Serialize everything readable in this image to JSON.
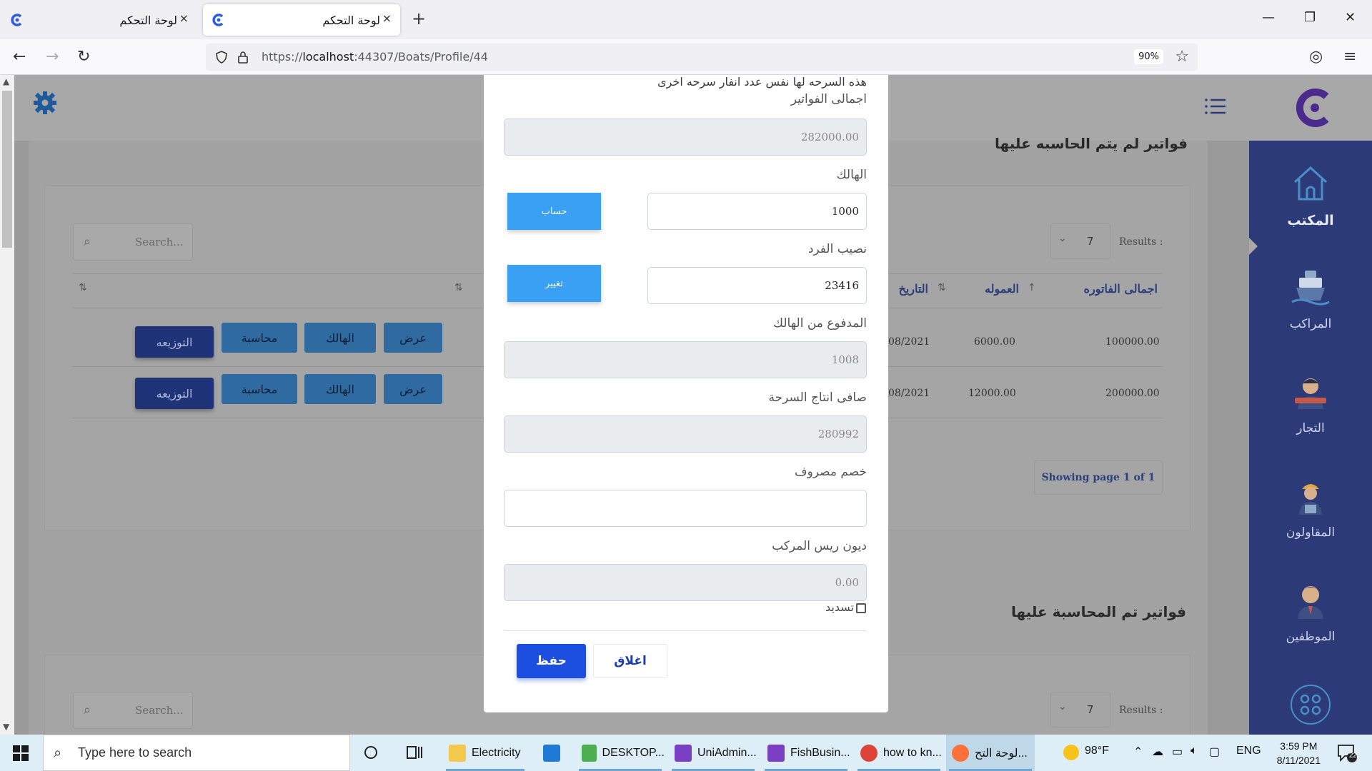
{
  "browser": {
    "tabs": [
      {
        "title": "لوحة التحكم",
        "active": false
      },
      {
        "title": "لوحة التحكم",
        "active": true
      }
    ],
    "url_prefix": "https://",
    "url_host": "localhost",
    "url_rest": ":44307/Boats/Profile/44",
    "zoom": "90%",
    "new_tab": "+",
    "close_glyph": "×",
    "minimize": "—",
    "restore": "❐",
    "close_window": "✕",
    "back": "←",
    "forward": "→",
    "reload": "↻",
    "star": "☆",
    "menu": "≡",
    "pocket": "◎"
  },
  "sidebar": {
    "items": [
      {
        "label": "المكتب",
        "icon": "house-icon",
        "active": true
      },
      {
        "label": "المراكب",
        "icon": "ship-icon",
        "active": false
      },
      {
        "label": "التجار",
        "icon": "merchant-icon",
        "active": false
      },
      {
        "label": "المقاولون",
        "icon": "contractor-icon",
        "active": false
      },
      {
        "label": "الموظفين",
        "icon": "employee-icon",
        "active": false
      }
    ]
  },
  "section1": {
    "title": "فواتير لم يتم الحاسبه عليها",
    "search_placeholder": "Search...",
    "results_label": "Results :",
    "results_value": "7",
    "columns": [
      "اجمالى الفاتوره",
      "العموله",
      "التاريخ"
    ],
    "rows": [
      {
        "total": "100000.00",
        "commission": "6000.00",
        "date": "08/2021"
      },
      {
        "total": "200000.00",
        "commission": "12000.00",
        "date": "08/2021"
      }
    ],
    "row_buttons": {
      "view": "عرض",
      "loss": "الهالك",
      "accounting": "محاسبة",
      "distribute": "التوزيعه"
    },
    "pager": "Showing page 1 of 1"
  },
  "section2": {
    "title": "فواتير تم المحاسبة عليها",
    "search_placeholder": "Search...",
    "results_label": "Results :",
    "results_value": "7"
  },
  "modal": {
    "notice": "هذه السرحه لها نفس عدد انفار سرحه اخرى",
    "invoices_total_label": "اجمالى الفواتير",
    "invoices_total_value": "282000.00",
    "loss_label": "الهالك",
    "loss_value": "1000",
    "calc_button": "حساب",
    "share_label": "نصيب الفرد",
    "share_value": "23416",
    "change_button": "تغيير",
    "paid_loss_label": "المدفوع من الهالك",
    "paid_loss_value": "1008",
    "net_label": "صافى انتاج السرحة",
    "net_value": "280992",
    "expense_label": "خصم مصروف",
    "expense_value": "",
    "debt_label": "ديون ريس المركب",
    "debt_value": "0.00",
    "repay_label": "تسديد",
    "save": "حفظ",
    "close": "اغلاق"
  },
  "taskbar": {
    "search_text": "Type here to search",
    "apps": [
      {
        "label": "Electricity"
      },
      {
        "label": ""
      },
      {
        "label": "DESKTOP..."
      },
      {
        "label": "UniAdmin..."
      },
      {
        "label": "FishBusin..."
      },
      {
        "label": "how to kn..."
      },
      {
        "label": "لوحة التح..."
      }
    ],
    "weather": "98°F",
    "lang": "ENG",
    "time": "3:59 PM",
    "date": "8/11/2021",
    "notifications": "22"
  }
}
